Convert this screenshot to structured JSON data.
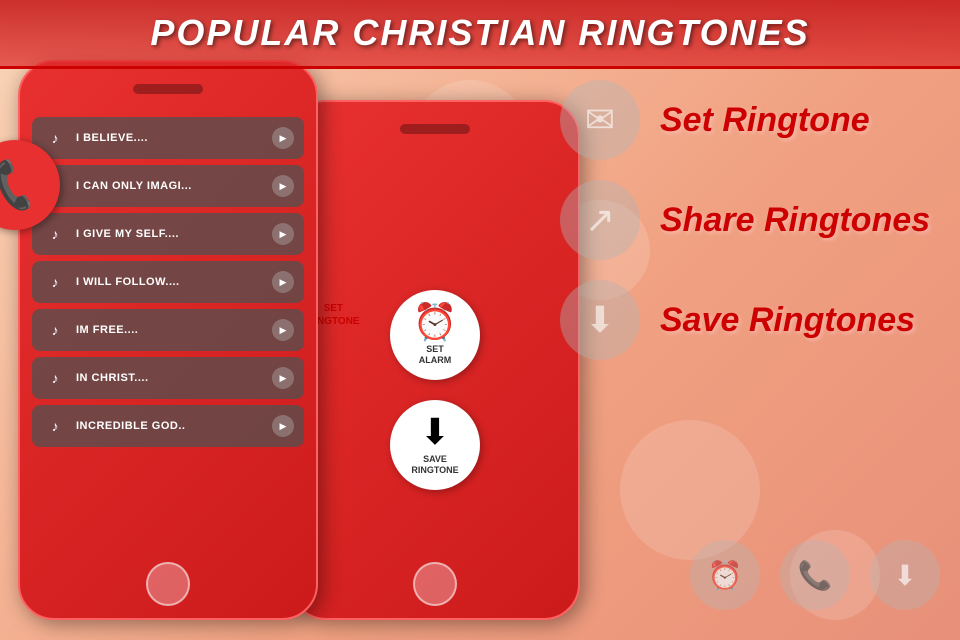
{
  "header": {
    "title": "POPULAR CHRISTIAN RINGTONES"
  },
  "songs": [
    {
      "name": "I BELIEVE...."
    },
    {
      "name": "I CAN ONLY IMAGI..."
    },
    {
      "name": "I GIVE MY SELF...."
    },
    {
      "name": "I WILL FOLLOW...."
    },
    {
      "name": "IM FREE...."
    },
    {
      "name": "IN CHRIST...."
    },
    {
      "name": "INCREDIBLE GOD.."
    }
  ],
  "actions": {
    "set_alarm": "SET\nALARM",
    "save_ringtone": "SAVE\nRINGTONE",
    "set_ringtone_label": "SET\nRINGTONE"
  },
  "info_panel": {
    "set_ringtone": "Set Ringtone",
    "share_ringtones": "Share Ringtones",
    "save_ringtones": "Save Ringtones"
  },
  "icons": {
    "music": "♪",
    "play": "▶",
    "phone": "📞",
    "alarm": "⏰",
    "download": "⬇",
    "share": "↗",
    "messenger": "✉",
    "call": "📱"
  }
}
